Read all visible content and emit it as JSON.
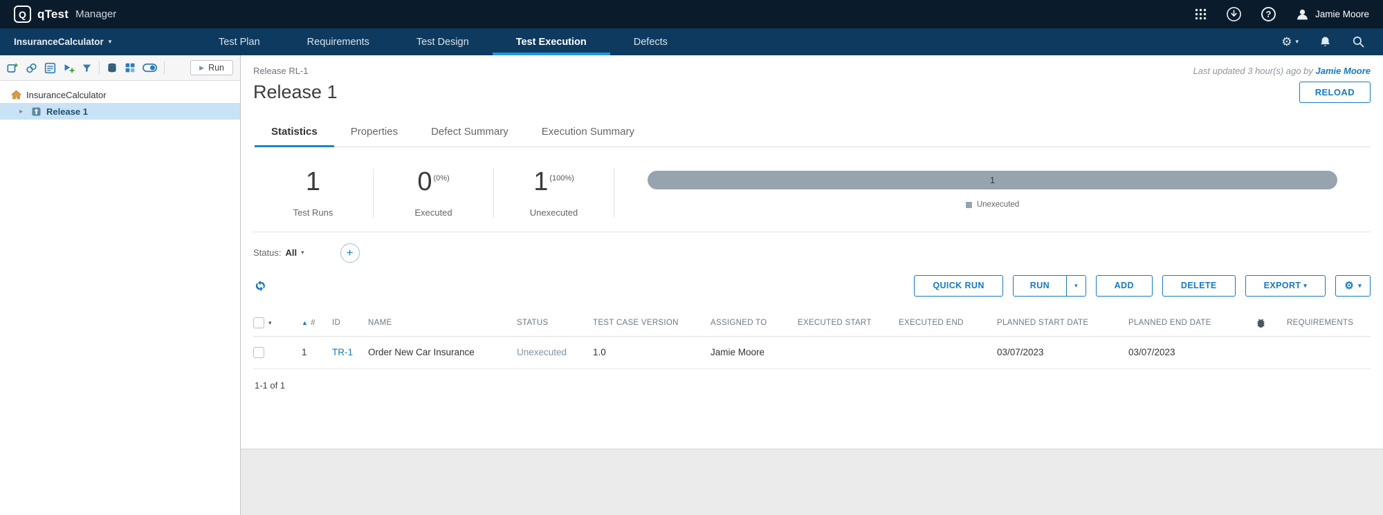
{
  "topbar": {
    "logo_letter": "Q",
    "brand": "qTest",
    "product": "Manager",
    "user_name": "Jamie Moore"
  },
  "nav": {
    "project": "InsuranceCalculator",
    "items": [
      {
        "label": "Test Plan"
      },
      {
        "label": "Requirements"
      },
      {
        "label": "Test Design"
      },
      {
        "label": "Test Execution"
      },
      {
        "label": "Defects"
      }
    ]
  },
  "sidebar": {
    "run_label": "Run",
    "tree": {
      "root_label": "InsuranceCalculator",
      "release_label": "Release 1"
    }
  },
  "page": {
    "breadcrumb_type": "Release",
    "breadcrumb_id": "RL-1",
    "title": "Release 1",
    "last_updated_text": "Last updated 3 hour(s) ago by",
    "last_updated_user": "Jamie Moore",
    "reload_label": "RELOAD",
    "tabs": [
      {
        "label": "Statistics"
      },
      {
        "label": "Properties"
      },
      {
        "label": "Defect Summary"
      },
      {
        "label": "Execution Summary"
      }
    ]
  },
  "stats": {
    "test_runs_value": "1",
    "test_runs_label": "Test Runs",
    "executed_value": "0",
    "executed_pct": "(0%)",
    "executed_label": "Executed",
    "unexecuted_value": "1",
    "unexecuted_pct": "(100%)",
    "unexecuted_label": "Unexecuted"
  },
  "chart_data": {
    "type": "bar",
    "orientation": "horizontal",
    "categories": [
      "Unexecuted"
    ],
    "values": [
      1
    ],
    "total": 1,
    "bar_label": "1",
    "bar_color": "#97a3ae",
    "legend": [
      {
        "label": "Unexecuted",
        "color": "#97a3ae"
      }
    ]
  },
  "filters": {
    "status_label": "Status:",
    "status_value": "All"
  },
  "actions": {
    "quick_run": "QUICK RUN",
    "run": "RUN",
    "add": "ADD",
    "delete": "DELETE",
    "export": "EXPORT"
  },
  "grid": {
    "headers": {
      "num": "#",
      "id": "ID",
      "name": "NAME",
      "status": "STATUS",
      "version": "TEST CASE VERSION",
      "assigned": "ASSIGNED TO",
      "exec_start": "EXECUTED START",
      "exec_end": "EXECUTED END",
      "planned_start": "PLANNED START DATE",
      "planned_end": "PLANNED END DATE",
      "requirements": "REQUIREMENTS"
    },
    "rows": [
      {
        "num": "1",
        "id": "TR-1",
        "name": "Order New Car Insurance",
        "status": "Unexecuted",
        "version": "1.0",
        "assigned": "Jamie Moore",
        "exec_start": "",
        "exec_end": "",
        "planned_start": "03/07/2023",
        "planned_end": "03/07/2023",
        "requirements": ""
      }
    ],
    "footer": "1-1 of 1"
  },
  "colors": {
    "accent_blue": "#1779c4",
    "nav_underline": "#1e9ad8",
    "topbar_bg": "#0a1b2b",
    "navbar_bg": "#0e3a5f",
    "bar_gray": "#97a3ae",
    "tree_selected_bg": "#c9e2f5"
  },
  "icons": {
    "caret_down": "▾",
    "caret_right": "▸",
    "sort_asc": "▲",
    "plus": "+",
    "gear": "⚙",
    "help": "?",
    "play": "▶"
  }
}
